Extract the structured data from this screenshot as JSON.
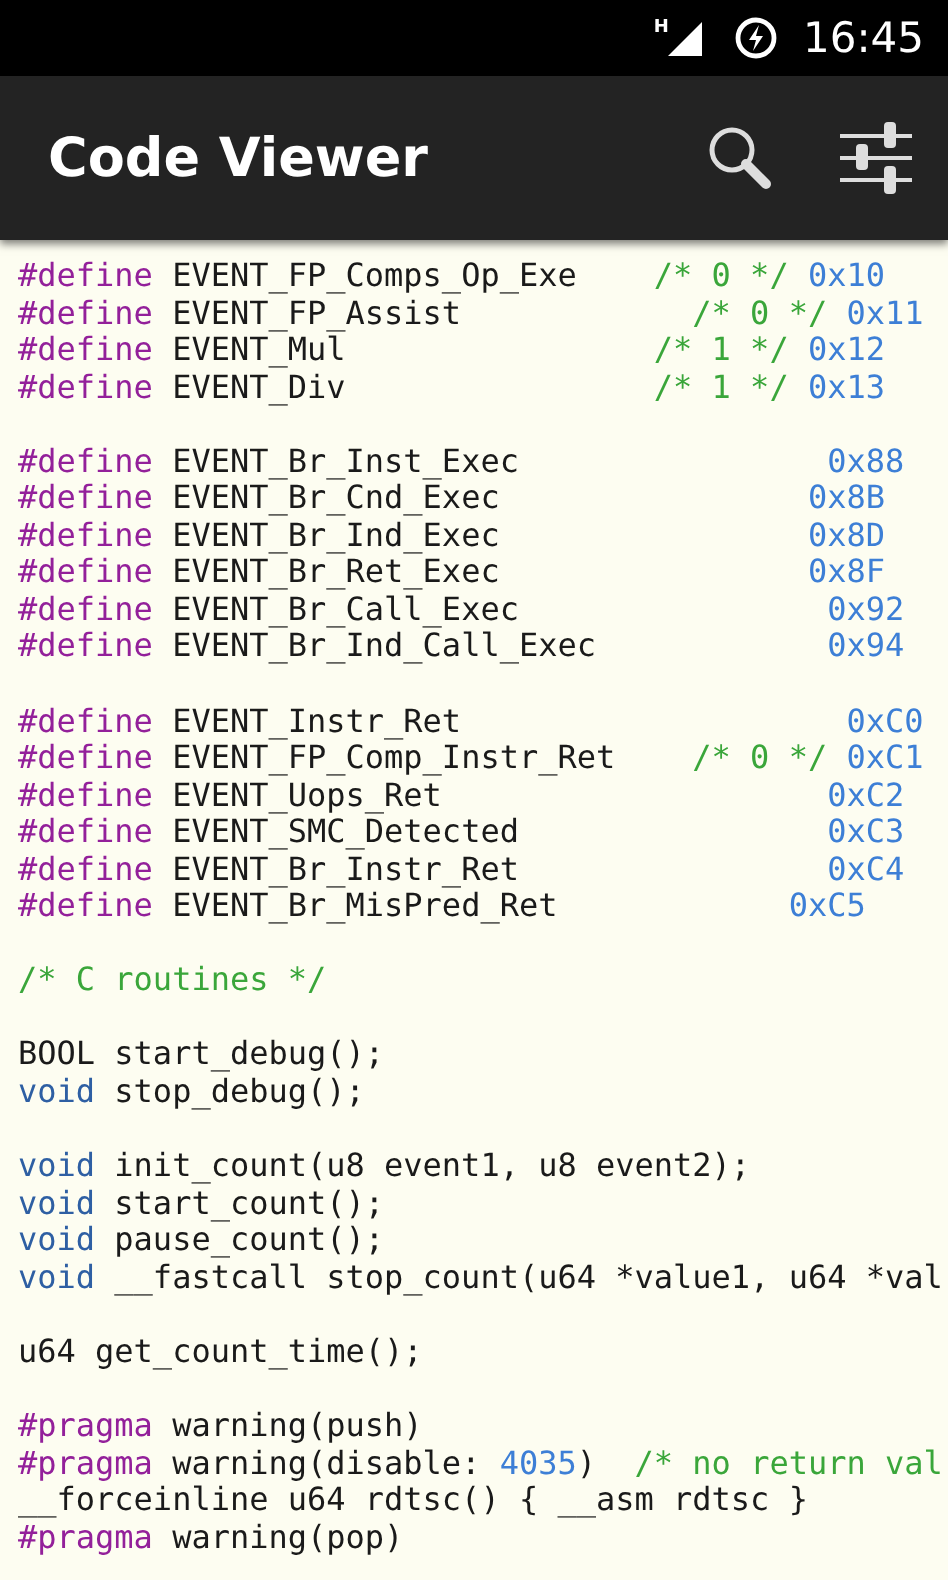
{
  "status_bar": {
    "network": "H",
    "time": "16:45"
  },
  "app_bar": {
    "title": "Code Viewer"
  },
  "code_lines": [
    {
      "kind": "code",
      "tokens": [
        {
          "kind": "directive",
          "text": "#define"
        },
        {
          "kind": "plain",
          "text": " EVENT_FP_Comps_Op_Exe    "
        },
        {
          "kind": "comment",
          "text": "/* 0 */"
        },
        {
          "kind": "number",
          "text": " 0x10"
        }
      ]
    },
    {
      "kind": "code",
      "tokens": [
        {
          "kind": "directive",
          "text": "#define"
        },
        {
          "kind": "plain",
          "text": " EVENT_FP_Assist            "
        },
        {
          "kind": "comment",
          "text": "/* 0 */"
        },
        {
          "kind": "number",
          "text": " 0x11"
        }
      ]
    },
    {
      "kind": "code",
      "tokens": [
        {
          "kind": "directive",
          "text": "#define"
        },
        {
          "kind": "plain",
          "text": " EVENT_Mul                "
        },
        {
          "kind": "comment",
          "text": "/* 1 */"
        },
        {
          "kind": "number",
          "text": " 0x12"
        }
      ]
    },
    {
      "kind": "code",
      "tokens": [
        {
          "kind": "directive",
          "text": "#define"
        },
        {
          "kind": "plain",
          "text": " EVENT_Div                "
        },
        {
          "kind": "comment",
          "text": "/* 1 */"
        },
        {
          "kind": "number",
          "text": " 0x13"
        }
      ]
    },
    {
      "kind": "blank"
    },
    {
      "kind": "code",
      "tokens": [
        {
          "kind": "directive",
          "text": "#define"
        },
        {
          "kind": "plain",
          "text": " EVENT_Br_Inst_Exec                "
        },
        {
          "kind": "number",
          "text": "0x88"
        }
      ]
    },
    {
      "kind": "code",
      "tokens": [
        {
          "kind": "directive",
          "text": "#define"
        },
        {
          "kind": "plain",
          "text": " EVENT_Br_Cnd_Exec                "
        },
        {
          "kind": "number",
          "text": "0x8B"
        }
      ]
    },
    {
      "kind": "code",
      "tokens": [
        {
          "kind": "directive",
          "text": "#define"
        },
        {
          "kind": "plain",
          "text": " EVENT_Br_Ind_Exec                "
        },
        {
          "kind": "number",
          "text": "0x8D"
        }
      ]
    },
    {
      "kind": "code",
      "tokens": [
        {
          "kind": "directive",
          "text": "#define"
        },
        {
          "kind": "plain",
          "text": " EVENT_Br_Ret_Exec                "
        },
        {
          "kind": "number",
          "text": "0x8F"
        }
      ]
    },
    {
      "kind": "code",
      "tokens": [
        {
          "kind": "directive",
          "text": "#define"
        },
        {
          "kind": "plain",
          "text": " EVENT_Br_Call_Exec                "
        },
        {
          "kind": "number",
          "text": "0x92"
        }
      ]
    },
    {
      "kind": "code",
      "tokens": [
        {
          "kind": "directive",
          "text": "#define"
        },
        {
          "kind": "plain",
          "text": " EVENT_Br_Ind_Call_Exec            "
        },
        {
          "kind": "number",
          "text": "0x94"
        }
      ]
    },
    {
      "kind": "blank"
    },
    {
      "kind": "code",
      "tokens": [
        {
          "kind": "directive",
          "text": "#define"
        },
        {
          "kind": "plain",
          "text": " EVENT_Instr_Ret                    "
        },
        {
          "kind": "number",
          "text": "0xC0"
        }
      ]
    },
    {
      "kind": "code",
      "tokens": [
        {
          "kind": "directive",
          "text": "#define"
        },
        {
          "kind": "plain",
          "text": " EVENT_FP_Comp_Instr_Ret    "
        },
        {
          "kind": "comment",
          "text": "/* 0 */"
        },
        {
          "kind": "number",
          "text": " 0xC1"
        }
      ]
    },
    {
      "kind": "code",
      "tokens": [
        {
          "kind": "directive",
          "text": "#define"
        },
        {
          "kind": "plain",
          "text": " EVENT_Uops_Ret                    "
        },
        {
          "kind": "number",
          "text": "0xC2"
        }
      ]
    },
    {
      "kind": "code",
      "tokens": [
        {
          "kind": "directive",
          "text": "#define"
        },
        {
          "kind": "plain",
          "text": " EVENT_SMC_Detected                "
        },
        {
          "kind": "number",
          "text": "0xC3"
        }
      ]
    },
    {
      "kind": "code",
      "tokens": [
        {
          "kind": "directive",
          "text": "#define"
        },
        {
          "kind": "plain",
          "text": " EVENT_Br_Instr_Ret                "
        },
        {
          "kind": "number",
          "text": "0xC4"
        }
      ]
    },
    {
      "kind": "code",
      "tokens": [
        {
          "kind": "directive",
          "text": "#define"
        },
        {
          "kind": "plain",
          "text": " EVENT_Br_MisPred_Ret            "
        },
        {
          "kind": "number",
          "text": "0xC5"
        }
      ]
    },
    {
      "kind": "blank"
    },
    {
      "kind": "code",
      "tokens": [
        {
          "kind": "comment",
          "text": "/* C routines */"
        }
      ]
    },
    {
      "kind": "blank"
    },
    {
      "kind": "code",
      "tokens": [
        {
          "kind": "plain",
          "text": "BOOL start_debug();"
        }
      ]
    },
    {
      "kind": "code",
      "tokens": [
        {
          "kind": "keyword",
          "text": "void"
        },
        {
          "kind": "plain",
          "text": " stop_debug();"
        }
      ]
    },
    {
      "kind": "blank"
    },
    {
      "kind": "code",
      "tokens": [
        {
          "kind": "keyword",
          "text": "void"
        },
        {
          "kind": "plain",
          "text": " init_count(u8 event1, u8 event2);"
        }
      ]
    },
    {
      "kind": "code",
      "tokens": [
        {
          "kind": "keyword",
          "text": "void"
        },
        {
          "kind": "plain",
          "text": " start_count();"
        }
      ]
    },
    {
      "kind": "code",
      "tokens": [
        {
          "kind": "keyword",
          "text": "void"
        },
        {
          "kind": "plain",
          "text": " pause_count();"
        }
      ]
    },
    {
      "kind": "code",
      "tokens": [
        {
          "kind": "keyword",
          "text": "void"
        },
        {
          "kind": "plain",
          "text": " __fastcall stop_count(u64 *value1, u64 *val"
        }
      ]
    },
    {
      "kind": "blank"
    },
    {
      "kind": "code",
      "tokens": [
        {
          "kind": "plain",
          "text": "u64 get_count_time();"
        }
      ]
    },
    {
      "kind": "blank"
    },
    {
      "kind": "code",
      "tokens": [
        {
          "kind": "directive",
          "text": "#pragma"
        },
        {
          "kind": "plain",
          "text": " warning(push)"
        }
      ]
    },
    {
      "kind": "code",
      "tokens": [
        {
          "kind": "directive",
          "text": "#pragma"
        },
        {
          "kind": "plain",
          "text": " warning(disable: "
        },
        {
          "kind": "number",
          "text": "4035"
        },
        {
          "kind": "plain",
          "text": ")  "
        },
        {
          "kind": "comment",
          "text": "/* no return val"
        }
      ]
    },
    {
      "kind": "code",
      "tokens": [
        {
          "kind": "plain",
          "text": "__forceinline u64 rdtsc() { __asm rdtsc }"
        }
      ]
    },
    {
      "kind": "code",
      "tokens": [
        {
          "kind": "directive",
          "text": "#pragma"
        },
        {
          "kind": "plain",
          "text": " warning(pop)"
        }
      ]
    }
  ]
}
